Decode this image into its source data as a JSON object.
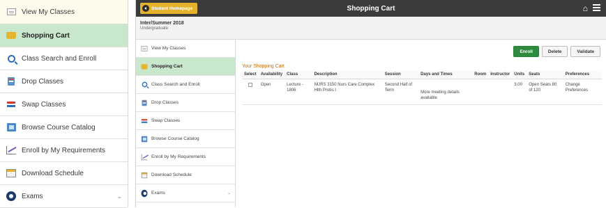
{
  "zoomed_sidebar": {
    "items": [
      {
        "label": "View My Classes",
        "icon": "classes-icon"
      },
      {
        "label": "Shopping Cart",
        "icon": "cart-icon"
      },
      {
        "label": "Class Search and Enroll",
        "icon": "search-icon"
      },
      {
        "label": "Drop Classes",
        "icon": "drop-icon"
      },
      {
        "label": "Swap Classes",
        "icon": "swap-icon"
      },
      {
        "label": "Browse Course Catalog",
        "icon": "catalog-icon"
      },
      {
        "label": "Enroll by My Requirements",
        "icon": "requirements-icon"
      },
      {
        "label": "Download Schedule",
        "icon": "schedule-icon"
      },
      {
        "label": "Exams",
        "icon": "exams-icon"
      }
    ]
  },
  "header": {
    "homepage_label": "Student Homepage",
    "title": "Shopping Cart"
  },
  "term": {
    "title": "Inter/Summer 2018",
    "career": "Undergraduate"
  },
  "sidebar": {
    "items": [
      {
        "label": "View My Classes"
      },
      {
        "label": "Shopping Cart"
      },
      {
        "label": "Class Search and Enroll"
      },
      {
        "label": "Drop Classes"
      },
      {
        "label": "Swap Classes"
      },
      {
        "label": "Browse Course Catalog"
      },
      {
        "label": "Enroll by My Requirements"
      },
      {
        "label": "Download Schedule"
      },
      {
        "label": "Exams"
      }
    ]
  },
  "actions": {
    "enroll": "Enroll",
    "delete": "Delete",
    "validate": "Validate"
  },
  "cart": {
    "heading": "Your Shopping Cart",
    "columns": [
      "Select",
      "Availability",
      "Class",
      "Description",
      "Session",
      "Days and Times",
      "Room",
      "Instructor",
      "Units",
      "Seats",
      "Preferences"
    ],
    "rows": [
      {
        "select": "",
        "availability": "Open",
        "class": "Lecture - 1806",
        "description": "NURS 3150 Nurs Care Complex Hlth Probs I",
        "session": "Second Half of Term",
        "days_times": "More meeting details available",
        "room": "",
        "instructor": "",
        "units": "3.00",
        "seats": "Open Seats 80 of 120",
        "preferences": "Change Preferences"
      }
    ]
  },
  "colors": {
    "active_item": "#c9e7cd",
    "topbar": "#3b3b3b",
    "homepage_button": "#e5b22c",
    "enroll_button": "#2e8b3d",
    "heading_orange": "#c96a00",
    "link_blue": "#3b5fb5"
  }
}
